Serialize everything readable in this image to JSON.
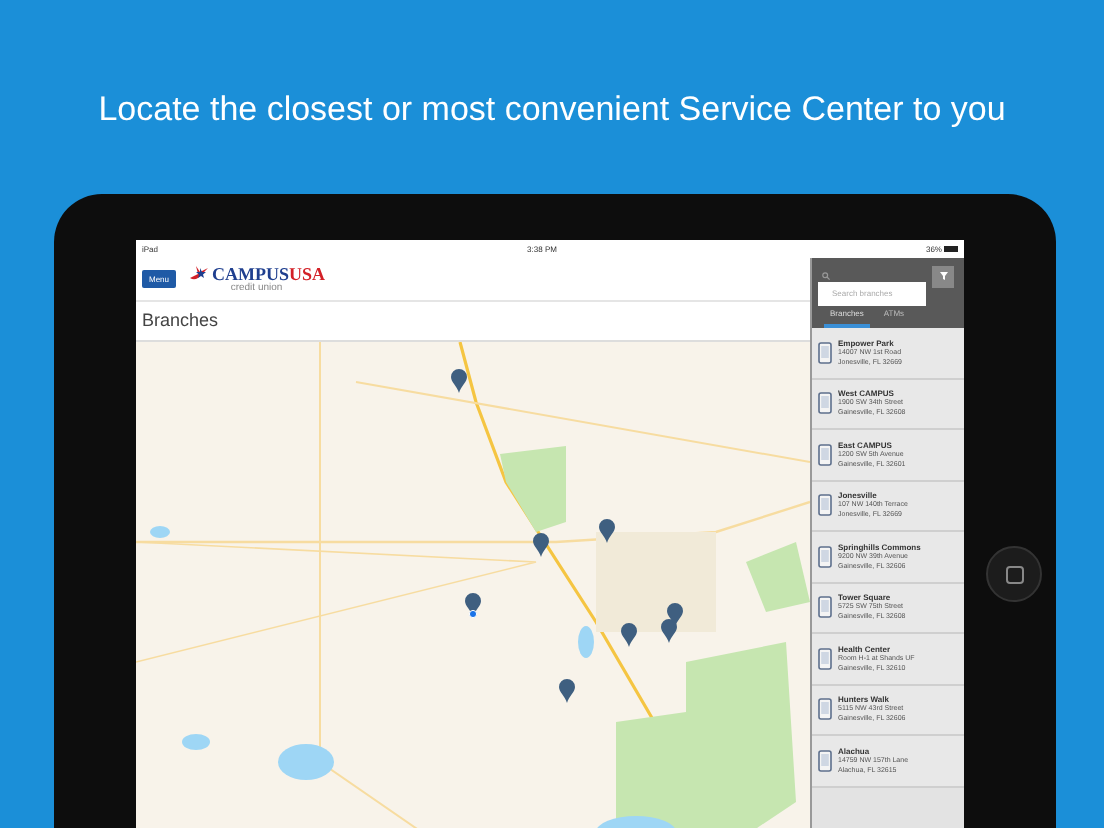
{
  "headline": "Locate the closest or most convenient Service Center to you",
  "status_bar": {
    "device": "iPad",
    "time": "3:38 PM",
    "battery": "36%"
  },
  "header": {
    "menu_button": "Menu",
    "logo": "CAMPUS",
    "logo_accent": "USA",
    "logo_sub": "credit union"
  },
  "page_title": "Branches",
  "map": {
    "kind": "picture",
    "pins": [
      {
        "current": false
      },
      {
        "current": false
      },
      {
        "current": false
      },
      {
        "current": true
      },
      {
        "current": false
      },
      {
        "current": false
      },
      {
        "current": false
      },
      {
        "current": false
      }
    ]
  },
  "search": {
    "placeholder": "Search branches"
  },
  "tabs": [
    {
      "label": "Branches",
      "selected": true
    },
    {
      "label": "ATMs",
      "selected": false
    }
  ],
  "branches": [
    {
      "name": "Empower Park",
      "street": "14007 NW 1st Road",
      "city": "Jonesville, FL 32669"
    },
    {
      "name": "West CAMPUS",
      "street": "1900 SW 34th Street",
      "city": "Gainesville, FL 32608"
    },
    {
      "name": "East CAMPUS",
      "street": "1200 SW 5th Avenue",
      "city": "Gainesville, FL 32601"
    },
    {
      "name": "Jonesville",
      "street": "107 NW 140th Terrace",
      "city": "Jonesville, FL 32669"
    },
    {
      "name": "Springhills Commons",
      "street": "9200 NW 39th Avenue",
      "city": "Gainesville, FL 32606"
    },
    {
      "name": "Tower Square",
      "street": "5725 SW 75th Street",
      "city": "Gainesville, FL 32608"
    },
    {
      "name": "Health Center",
      "street": "Room H-1 at Shands UF",
      "city": "Gainesville, FL 32610"
    },
    {
      "name": "Hunters Walk",
      "street": "5115 NW 43rd Street",
      "city": "Gainesville, FL 32606"
    },
    {
      "name": "Alachua",
      "street": "14759 NW 157th Lane",
      "city": "Alachua, FL 32615"
    }
  ]
}
